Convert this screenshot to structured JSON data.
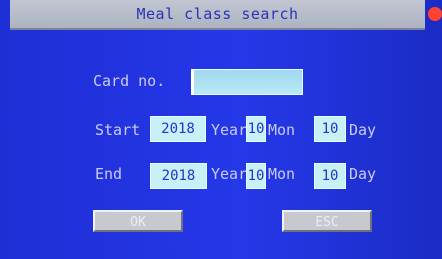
{
  "window": {
    "title": "Meal class search"
  },
  "form": {
    "card_label": "Card no.",
    "card_value": "",
    "start_label": "Start",
    "end_label": "End",
    "start": {
      "year": "2018",
      "month": "10",
      "day": "10"
    },
    "end": {
      "year": "2018",
      "month": "10",
      "day": "10"
    },
    "year_unit": "Year",
    "month_unit": "Mon",
    "day_unit": "Day"
  },
  "buttons": {
    "ok_label": "OK",
    "esc_label": "ESC"
  },
  "colors": {
    "screen_blue": "#2538e8",
    "title_bar": "#b8bdcb",
    "field_fill": "#c7f0f7",
    "button_fill": "#c8c9cf"
  }
}
